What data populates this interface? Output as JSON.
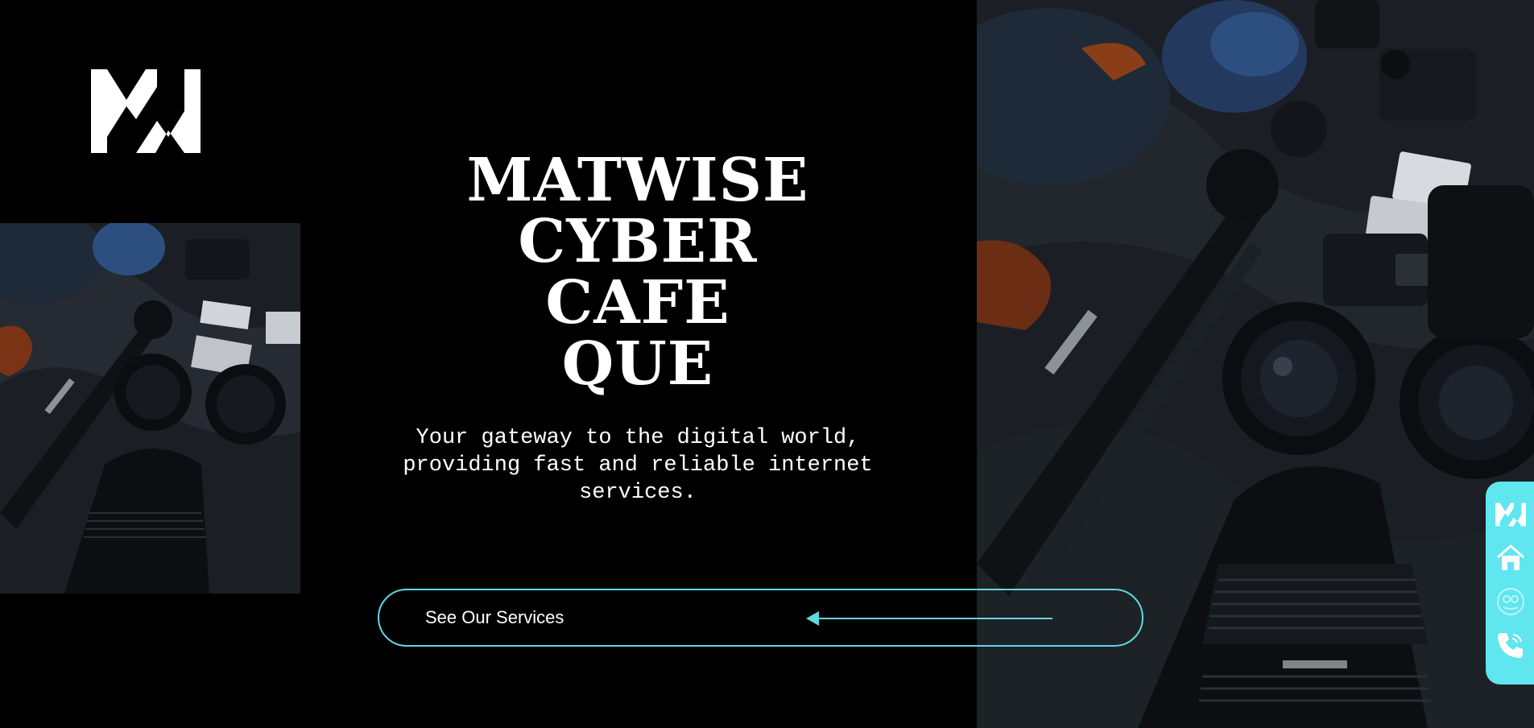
{
  "hero": {
    "title_lines": [
      "MATWISE",
      "CYBER",
      "CAFE",
      "QUE"
    ],
    "subtitle": "Your gateway to the digital world, providing fast and reliable internet services.",
    "cta_label": "See Our Services"
  },
  "logo": {
    "icon": "mw-logo-icon",
    "color": "#ffffff"
  },
  "side_nav": {
    "background": "#5fe6ee",
    "items": [
      {
        "icon": "mw-logo-icon"
      },
      {
        "icon": "home-icon"
      },
      {
        "icon": "services-icon"
      },
      {
        "icon": "phone-icon"
      }
    ]
  },
  "colors": {
    "accent": "#5fd8e0",
    "background": "#000000",
    "text": "#ffffff"
  }
}
